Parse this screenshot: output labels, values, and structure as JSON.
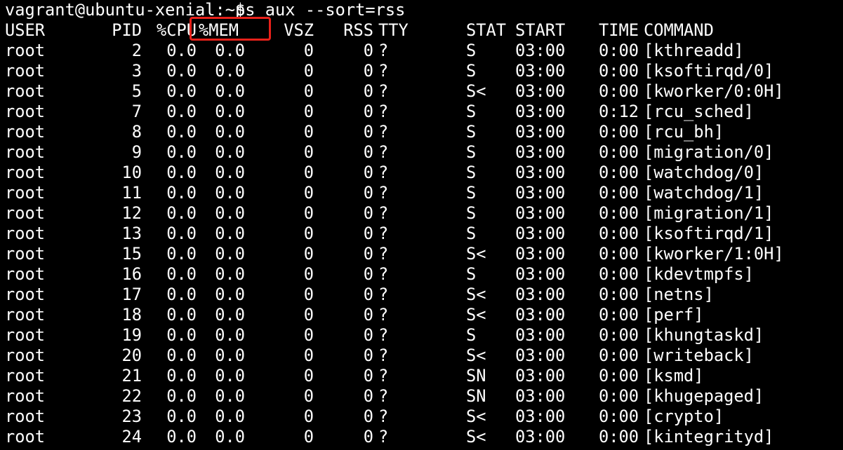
{
  "terminal": {
    "prompt": "vagrant@ubuntu-xenial:~$",
    "command": "ps aux --sort=rss",
    "highlight_color": "#e8211a",
    "background_color": "#000000",
    "text_color": "#ffffff",
    "highlighted_column": "%MEM"
  },
  "headers": {
    "user": "USER",
    "pid": "PID",
    "cpu": "%CPU",
    "mem": "%MEM",
    "vsz": "VSZ",
    "rss": "RSS",
    "tty": "TTY",
    "stat": "STAT",
    "start": "START",
    "time": "TIME",
    "command": "COMMAND"
  },
  "rows": [
    {
      "user": "root",
      "pid": "2",
      "cpu": "0.0",
      "mem": "0.0",
      "vsz": "0",
      "rss": "0",
      "tty": "?",
      "stat": "S",
      "start": "03:00",
      "time": "0:00",
      "command": "[kthreadd]"
    },
    {
      "user": "root",
      "pid": "3",
      "cpu": "0.0",
      "mem": "0.0",
      "vsz": "0",
      "rss": "0",
      "tty": "?",
      "stat": "S",
      "start": "03:00",
      "time": "0:00",
      "command": "[ksoftirqd/0]"
    },
    {
      "user": "root",
      "pid": "5",
      "cpu": "0.0",
      "mem": "0.0",
      "vsz": "0",
      "rss": "0",
      "tty": "?",
      "stat": "S<",
      "start": "03:00",
      "time": "0:00",
      "command": "[kworker/0:0H]"
    },
    {
      "user": "root",
      "pid": "7",
      "cpu": "0.0",
      "mem": "0.0",
      "vsz": "0",
      "rss": "0",
      "tty": "?",
      "stat": "S",
      "start": "03:00",
      "time": "0:12",
      "command": "[rcu_sched]"
    },
    {
      "user": "root",
      "pid": "8",
      "cpu": "0.0",
      "mem": "0.0",
      "vsz": "0",
      "rss": "0",
      "tty": "?",
      "stat": "S",
      "start": "03:00",
      "time": "0:00",
      "command": "[rcu_bh]"
    },
    {
      "user": "root",
      "pid": "9",
      "cpu": "0.0",
      "mem": "0.0",
      "vsz": "0",
      "rss": "0",
      "tty": "?",
      "stat": "S",
      "start": "03:00",
      "time": "0:00",
      "command": "[migration/0]"
    },
    {
      "user": "root",
      "pid": "10",
      "cpu": "0.0",
      "mem": "0.0",
      "vsz": "0",
      "rss": "0",
      "tty": "?",
      "stat": "S",
      "start": "03:00",
      "time": "0:00",
      "command": "[watchdog/0]"
    },
    {
      "user": "root",
      "pid": "11",
      "cpu": "0.0",
      "mem": "0.0",
      "vsz": "0",
      "rss": "0",
      "tty": "?",
      "stat": "S",
      "start": "03:00",
      "time": "0:00",
      "command": "[watchdog/1]"
    },
    {
      "user": "root",
      "pid": "12",
      "cpu": "0.0",
      "mem": "0.0",
      "vsz": "0",
      "rss": "0",
      "tty": "?",
      "stat": "S",
      "start": "03:00",
      "time": "0:00",
      "command": "[migration/1]"
    },
    {
      "user": "root",
      "pid": "13",
      "cpu": "0.0",
      "mem": "0.0",
      "vsz": "0",
      "rss": "0",
      "tty": "?",
      "stat": "S",
      "start": "03:00",
      "time": "0:00",
      "command": "[ksoftirqd/1]"
    },
    {
      "user": "root",
      "pid": "15",
      "cpu": "0.0",
      "mem": "0.0",
      "vsz": "0",
      "rss": "0",
      "tty": "?",
      "stat": "S<",
      "start": "03:00",
      "time": "0:00",
      "command": "[kworker/1:0H]"
    },
    {
      "user": "root",
      "pid": "16",
      "cpu": "0.0",
      "mem": "0.0",
      "vsz": "0",
      "rss": "0",
      "tty": "?",
      "stat": "S",
      "start": "03:00",
      "time": "0:00",
      "command": "[kdevtmpfs]"
    },
    {
      "user": "root",
      "pid": "17",
      "cpu": "0.0",
      "mem": "0.0",
      "vsz": "0",
      "rss": "0",
      "tty": "?",
      "stat": "S<",
      "start": "03:00",
      "time": "0:00",
      "command": "[netns]"
    },
    {
      "user": "root",
      "pid": "18",
      "cpu": "0.0",
      "mem": "0.0",
      "vsz": "0",
      "rss": "0",
      "tty": "?",
      "stat": "S<",
      "start": "03:00",
      "time": "0:00",
      "command": "[perf]"
    },
    {
      "user": "root",
      "pid": "19",
      "cpu": "0.0",
      "mem": "0.0",
      "vsz": "0",
      "rss": "0",
      "tty": "?",
      "stat": "S",
      "start": "03:00",
      "time": "0:00",
      "command": "[khungtaskd]"
    },
    {
      "user": "root",
      "pid": "20",
      "cpu": "0.0",
      "mem": "0.0",
      "vsz": "0",
      "rss": "0",
      "tty": "?",
      "stat": "S<",
      "start": "03:00",
      "time": "0:00",
      "command": "[writeback]"
    },
    {
      "user": "root",
      "pid": "21",
      "cpu": "0.0",
      "mem": "0.0",
      "vsz": "0",
      "rss": "0",
      "tty": "?",
      "stat": "SN",
      "start": "03:00",
      "time": "0:00",
      "command": "[ksmd]"
    },
    {
      "user": "root",
      "pid": "22",
      "cpu": "0.0",
      "mem": "0.0",
      "vsz": "0",
      "rss": "0",
      "tty": "?",
      "stat": "SN",
      "start": "03:00",
      "time": "0:00",
      "command": "[khugepaged]"
    },
    {
      "user": "root",
      "pid": "23",
      "cpu": "0.0",
      "mem": "0.0",
      "vsz": "0",
      "rss": "0",
      "tty": "?",
      "stat": "S<",
      "start": "03:00",
      "time": "0:00",
      "command": "[crypto]"
    },
    {
      "user": "root",
      "pid": "24",
      "cpu": "0.0",
      "mem": "0.0",
      "vsz": "0",
      "rss": "0",
      "tty": "?",
      "stat": "S<",
      "start": "03:00",
      "time": "0:00",
      "command": "[kintegrityd]"
    }
  ]
}
